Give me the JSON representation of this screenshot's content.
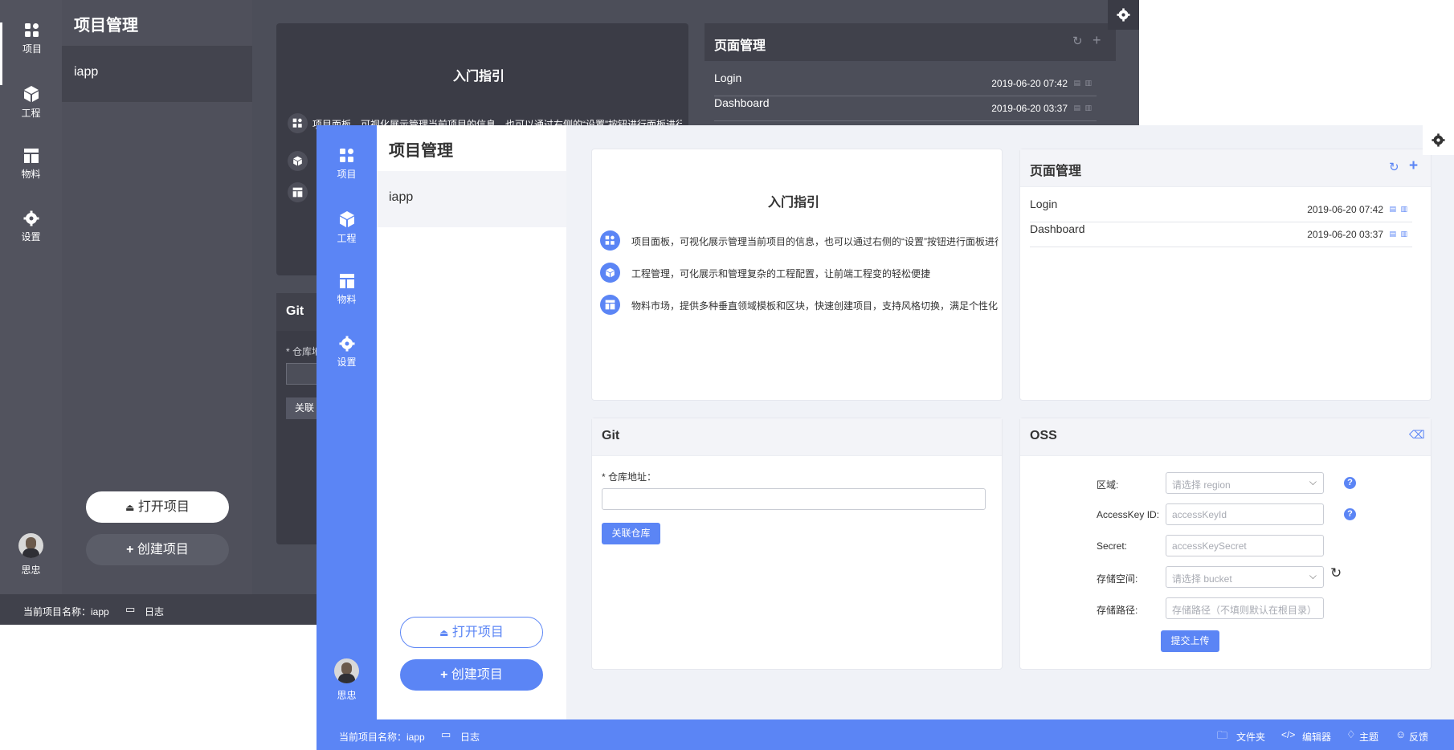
{
  "app": {
    "title": "项目管理",
    "project_item": "iapp",
    "open_project": "打开项目",
    "create_project": "创建项目",
    "user_name": "思忠"
  },
  "rail": {
    "items": [
      {
        "label": "项目",
        "icon": "grid-icon"
      },
      {
        "label": "工程",
        "icon": "cube-icon"
      },
      {
        "label": "物料",
        "icon": "layout-icon"
      },
      {
        "label": "设置",
        "icon": "gear-icon"
      }
    ]
  },
  "guide": {
    "title": "入门指引",
    "items": [
      {
        "text": "项目面板，可视化展示管理当前项目的信息，也可以通过右侧的“设置”按钮进行面板进行",
        "icon": "grid-icon"
      },
      {
        "text": "工程管理，可化展示和管理复杂的工程配置，让前端工程变的轻松便捷",
        "icon": "cube-icon"
      },
      {
        "text": "物料市场，提供多种垂直领域模板和区块，快速创建项目，支持风格切换，满足个性化",
        "icon": "layout-icon"
      }
    ]
  },
  "pages": {
    "title": "页面管理",
    "rows": [
      {
        "name": "Login",
        "date": "2019-06-20 07:42"
      },
      {
        "name": "Dashboard",
        "date": "2019-06-20 03:37"
      }
    ]
  },
  "git": {
    "title": "Git",
    "repo_label": "* 仓库地址：",
    "repo_label_cut": "* 仓库地",
    "repo_value": "",
    "link_button": "关联仓库",
    "link_button_cut": "关联"
  },
  "oss": {
    "title": "OSS",
    "region_label": "区域:",
    "region_placeholder": "请选择 region",
    "ak_label": "AccessKey ID:",
    "ak_placeholder": "accessKeyId",
    "secret_label": "Secret:",
    "secret_placeholder": "accessKeySecret",
    "bucket_label": "存储空间:",
    "bucket_placeholder": "请选择 bucket",
    "path_label": "存储路径:",
    "path_placeholder": "存储路径（不填则默认在根目录）",
    "submit": "提交上传",
    "help": "?"
  },
  "statusbar": {
    "project_name": "当前项目名称：iapp",
    "log": "日志",
    "folder": "文件夹",
    "editor": "编辑器",
    "theme": "主题",
    "feedback": "反馈"
  },
  "colors": {
    "accent": "#5b85f5",
    "dark_bg": "#4c4e59",
    "light_bg": "#f0f2f7"
  }
}
